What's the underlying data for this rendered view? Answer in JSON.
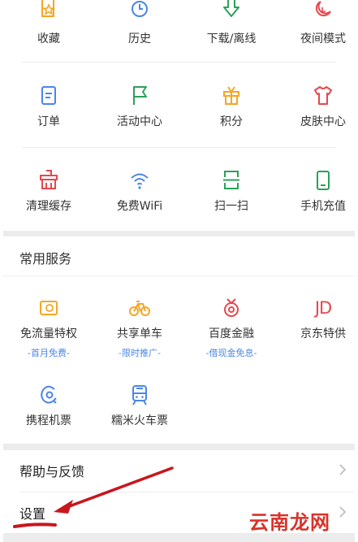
{
  "tools": [
    {
      "label": "收藏",
      "icon": "favorite-star-icon"
    },
    {
      "label": "历史",
      "icon": "clock-history-icon"
    },
    {
      "label": "下载/离线",
      "icon": "download-arrow-icon"
    },
    {
      "label": "夜间模式",
      "icon": "moon-night-icon"
    },
    {
      "label": "订单",
      "icon": "order-document-icon"
    },
    {
      "label": "活动中心",
      "icon": "flag-icon"
    },
    {
      "label": "积分",
      "icon": "gift-box-icon"
    },
    {
      "label": "皮肤中心",
      "icon": "tshirt-skin-icon"
    },
    {
      "label": "清理缓存",
      "icon": "broom-clean-icon"
    },
    {
      "label": "免费WiFi",
      "icon": "wifi-icon"
    },
    {
      "label": "扫一扫",
      "icon": "scan-icon"
    },
    {
      "label": "手机充值",
      "icon": "phone-recharge-icon"
    }
  ],
  "services": {
    "title": "常用服务",
    "items": [
      {
        "label": "免流量特权",
        "sub": "-首月免费-",
        "icon": "free-data-card-icon"
      },
      {
        "label": "共享单车",
        "sub": "-限时推广-",
        "icon": "bicycle-icon"
      },
      {
        "label": "百度金融",
        "sub": "-借现金免息-",
        "icon": "baidu-finance-icon"
      },
      {
        "label": "京东特供",
        "sub": "",
        "icon": "jd-logo-icon",
        "logo_text": "JD"
      },
      {
        "label": "携程机票",
        "sub": "",
        "icon": "ctrip-dolphin-icon"
      },
      {
        "label": "糯米火车票",
        "sub": "",
        "icon": "train-icon"
      }
    ]
  },
  "menu": {
    "help_label": "帮助与反馈",
    "settings_label": "设置"
  },
  "watermark_text": "云南龙网",
  "colors": {
    "orange": "#f5a623",
    "blue": "#4a86e8",
    "green": "#2ca05a",
    "red": "#e8474c",
    "annotation_red": "#c8161d"
  }
}
